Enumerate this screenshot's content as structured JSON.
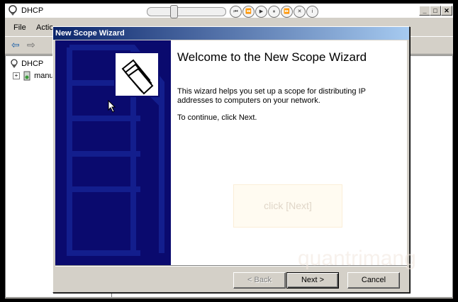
{
  "window": {
    "title": "DHCP",
    "controls": {
      "minimize": "_",
      "maximize": "□",
      "close": "✕"
    }
  },
  "media_player": {
    "buttons": [
      "⏮",
      "⏪",
      "▶",
      "⏸",
      "⏩",
      "✕",
      "i"
    ]
  },
  "menubar": {
    "items": [
      "File",
      "Actio"
    ]
  },
  "toolbar": {
    "back_icon": "⇦",
    "forward_icon": "⇨"
  },
  "tree": {
    "root_label": "DHCP",
    "child_label": "manu",
    "expander": "+"
  },
  "wizard": {
    "title": "New Scope Wizard",
    "heading": "Welcome to the New Scope Wizard",
    "description": "This wizard helps you set up a scope for distributing IP addresses to computers on your network.",
    "continue_text": "To continue, click Next.",
    "hint_text": "click [Next]",
    "buttons": {
      "back": "< Back",
      "next": "Next >",
      "cancel": "Cancel"
    }
  },
  "watermark": {
    "text": "quantrimang"
  },
  "colors": {
    "wizard_title": "#0a246a",
    "wizard_side": "#0a0a6e",
    "dialog_face": "#d4d0c8"
  }
}
